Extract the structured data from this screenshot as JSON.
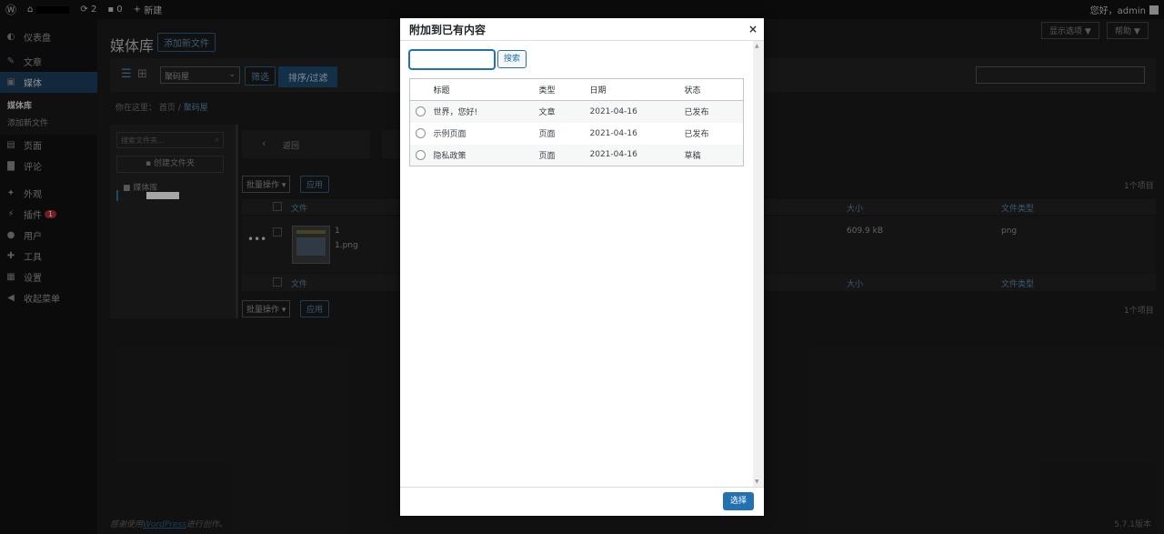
{
  "adminbar": {
    "updates": "2",
    "comments": "0",
    "new_label": "新建",
    "greeting": "您好，admin"
  },
  "sidebar": {
    "items": [
      {
        "label": "仪表盘",
        "icon": "dashboard-icon",
        "glyph": "◐"
      },
      {
        "label": "文章",
        "icon": "pin-icon",
        "glyph": "✎"
      },
      {
        "label": "媒体",
        "icon": "media-icon",
        "glyph": "▣"
      },
      {
        "label": "页面",
        "icon": "page-icon",
        "glyph": "▤"
      },
      {
        "label": "评论",
        "icon": "comment-icon",
        "glyph": "▇"
      },
      {
        "label": "外观",
        "icon": "brush-icon",
        "glyph": "✦"
      },
      {
        "label": "插件",
        "icon": "plugin-icon",
        "glyph": "⚡"
      },
      {
        "label": "用户",
        "icon": "user-icon",
        "glyph": "●"
      },
      {
        "label": "工具",
        "icon": "wrench-icon",
        "glyph": "✚"
      },
      {
        "label": "设置",
        "icon": "settings-icon",
        "glyph": "▦"
      },
      {
        "label": "收起菜单",
        "icon": "collapse-icon",
        "glyph": "◀"
      }
    ],
    "sub_current": "媒体库",
    "sub_add": "添加新文件",
    "plugins_badge": "1"
  },
  "main": {
    "title": "媒体库",
    "add_new": "添加新文件",
    "screen_options": "显示选项 ▼",
    "help": "帮助 ▼",
    "filter_select": "聚码屋",
    "filter_btn": "筛选",
    "sort_btn": "排序/过滤",
    "breadcrumb_prefix": "你在这里：",
    "breadcrumb_home": "首页",
    "breadcrumb_sep": "/",
    "breadcrumb_cur": "聚码屋",
    "folder_search_ph": "搜索文件夹...",
    "create_folder": "创建文件夹",
    "folder_root": "媒体库",
    "back": "返回",
    "bulk": "批量操作 ▾",
    "apply": "应用",
    "count": "1个项目",
    "col_file": "文件",
    "col_size": "大小",
    "col_type": "文件类型",
    "row_name": "1",
    "row_file": "1.png",
    "row_size": "609.9 kB",
    "row_type": "png",
    "footer_thanks_pre": "感谢使用",
    "footer_wp": "WordPress",
    "footer_thanks_post": "进行创作。",
    "version": "5.7.1版本"
  },
  "modal": {
    "title": "附加到已有内容",
    "close": "×",
    "search_btn": "搜索",
    "headers": {
      "title": "标题",
      "type": "类型",
      "date": "日期",
      "status": "状态"
    },
    "rows": [
      {
        "title": "世界，您好!",
        "type": "文章",
        "date": "2021-04-16",
        "status": "已发布"
      },
      {
        "title": "示例页面",
        "type": "页面",
        "date": "2021-04-16",
        "status": "已发布"
      },
      {
        "title": "隐私政策",
        "type": "页面",
        "date": "2021-04-16",
        "status": "草稿"
      }
    ],
    "select_btn": "选择"
  }
}
